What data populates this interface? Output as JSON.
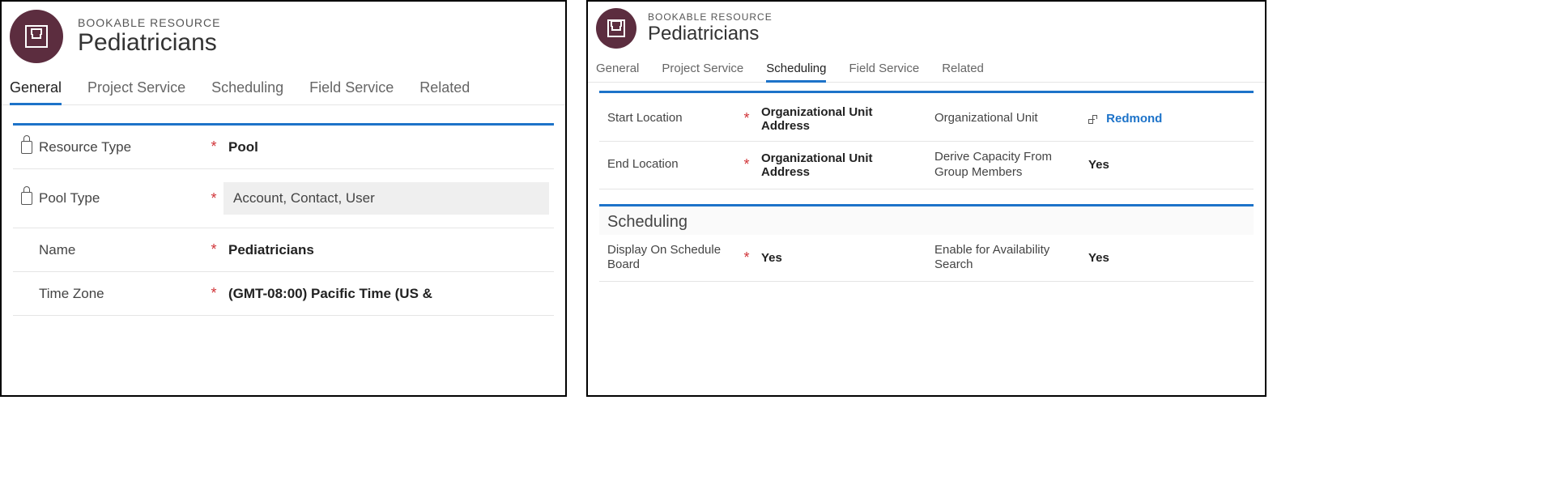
{
  "left": {
    "header": {
      "entity_label": "BOOKABLE RESOURCE",
      "title": "Pediatricians"
    },
    "tabs": [
      "General",
      "Project Service",
      "Scheduling",
      "Field Service",
      "Related"
    ],
    "active_tab": "General",
    "fields": {
      "resource_type": {
        "label": "Resource Type",
        "locked": true,
        "required": true,
        "value": "Pool"
      },
      "pool_type": {
        "label": "Pool Type",
        "locked": true,
        "required": true,
        "value": "Account, Contact, User"
      },
      "name": {
        "label": "Name",
        "locked": false,
        "required": true,
        "value": "Pediatricians"
      },
      "time_zone": {
        "label": "Time Zone",
        "locked": false,
        "required": true,
        "value": "(GMT-08:00) Pacific Time (US &"
      }
    }
  },
  "right": {
    "header": {
      "entity_label": "BOOKABLE RESOURCE",
      "title": "Pediatricians"
    },
    "tabs": [
      "General",
      "Project Service",
      "Scheduling",
      "Field Service",
      "Related"
    ],
    "active_tab": "Scheduling",
    "top_fields": {
      "start_location": {
        "label": "Start Location",
        "required": true,
        "value": "Organizational Unit Address"
      },
      "org_unit": {
        "label": "Organizational Unit",
        "required": false,
        "value": "Redmond",
        "is_link": true
      },
      "end_location": {
        "label": "End Location",
        "required": true,
        "value": "Organizational Unit Address"
      },
      "derive_cap": {
        "label": "Derive Capacity From Group Members",
        "required": false,
        "value": "Yes"
      }
    },
    "scheduling_section": {
      "title": "Scheduling",
      "display_on_board": {
        "label": "Display On Schedule Board",
        "required": true,
        "value": "Yes"
      },
      "enable_avail": {
        "label": "Enable for Availability Search",
        "required": false,
        "value": "Yes"
      }
    }
  }
}
